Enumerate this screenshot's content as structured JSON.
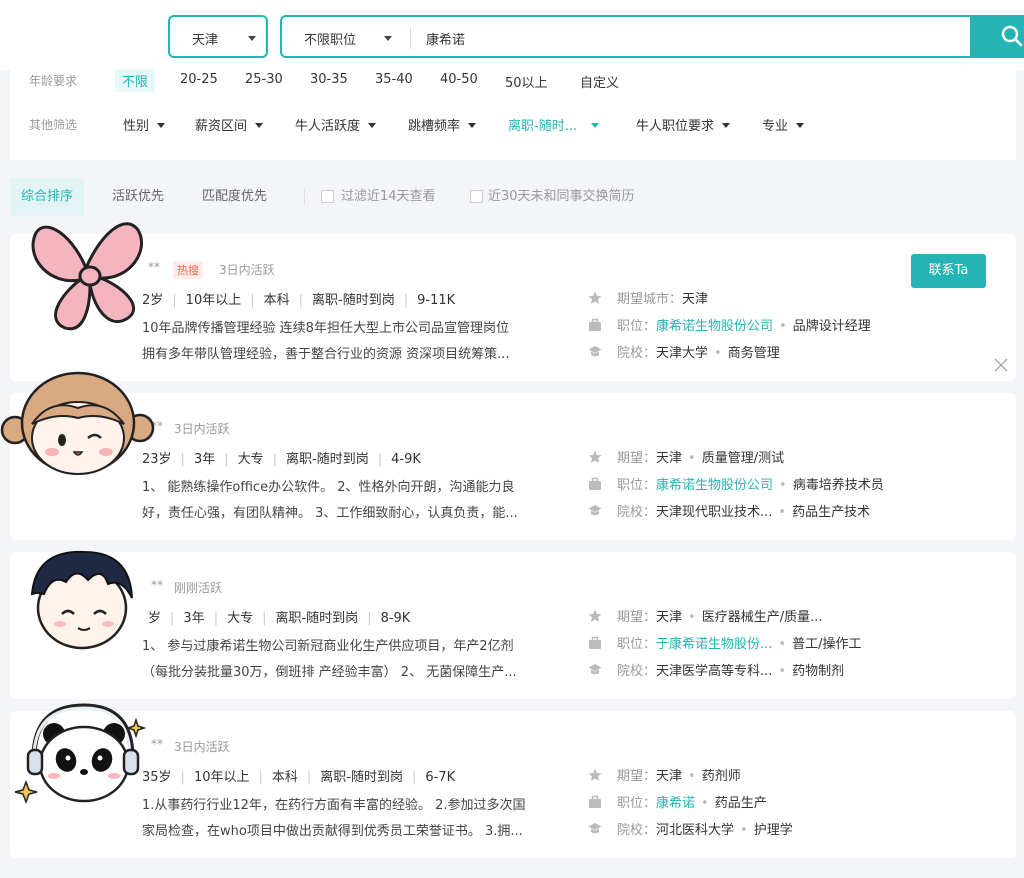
{
  "search": {
    "city": "天津",
    "position": "不限职位",
    "keyword": "康希诺"
  },
  "filters": {
    "age_label": "年龄要求",
    "age_options": [
      "不限",
      "20-25",
      "25-30",
      "30-35",
      "35-40",
      "40-50",
      "50以上",
      "自定义"
    ],
    "age_selected": "不限",
    "other_label": "其他筛选",
    "dropdowns": [
      "性别",
      "薪资区间",
      "牛人活跃度",
      "跳槽频率",
      "离职-随时...",
      "牛人职位要求",
      "专业"
    ],
    "active_dropdown": "离职-随时..."
  },
  "sort": {
    "tabs": [
      "综合排序",
      "活跃优先",
      "匹配度优先"
    ],
    "active": "综合排序",
    "checkboxes": [
      "过滤近14天查看",
      "近30天未和同事交换简历"
    ]
  },
  "candidates": [
    {
      "name": "**",
      "hot": "热搜",
      "active": "3日内活跃",
      "meta": [
        "2岁",
        "10年以上",
        "本科",
        "离职-随时到岗",
        "9-11K"
      ],
      "desc1": "10年品牌传播管理经验 连续8年担任大型上市公司品宣管理岗位",
      "desc2": "拥有多年带队管理经验，善于整合行业的资源 资深项目统筹策...",
      "expect_label": "期望城市：",
      "expect": "天津",
      "expect_extra": "",
      "job_label": "职位：",
      "company": "康希诺生物股份公司",
      "job": "品牌设计经理",
      "school_label": "院校：",
      "school": "天津大学",
      "major": "商务管理",
      "contact": "联系Ta"
    },
    {
      "name": "**",
      "hot": "",
      "active": "3日内活跃",
      "meta": [
        "23岁",
        "3年",
        "大专",
        "离职-随时到岗",
        "4-9K"
      ],
      "desc1": "1、 能熟练操作office办公软件。 2、性格外向开朗，沟通能力良",
      "desc2": "好，责任心强，有团队精神。 3、工作细致耐心，认真负责，能...",
      "expect_label": "期望：",
      "expect": "天津",
      "expect_extra": "质量管理/测试",
      "job_label": "职位：",
      "company": "康希诺生物股份公司",
      "job": "病毒培养技术员",
      "school_label": "院校：",
      "school": "天津现代职业技术...",
      "major": "药品生产技术"
    },
    {
      "name": "**",
      "hot": "",
      "active": "刚刚活跃",
      "meta": [
        "岁",
        "3年",
        "大专",
        "离职-随时到岗",
        "8-9K"
      ],
      "desc1": "1、 参与过康希诺生物公司新冠商业化生产供应项目，年产2亿剂",
      "desc2": "（每批分装批量30万，倒班排 产经验丰富） 2、 无菌保障生产...",
      "expect_label": "期望：",
      "expect": "天津",
      "expect_extra": "医疗器械生产/质量...",
      "job_label": "职位：",
      "company": "于康希诺生物股份...",
      "job": "普工/操作工",
      "school_label": "院校：",
      "school": "天津医学高等专科...",
      "major": "药物制剂"
    },
    {
      "name": "**",
      "hot": "",
      "active": "3日内活跃",
      "meta": [
        "35岁",
        "10年以上",
        "本科",
        "离职-随时到岗",
        "6-7K"
      ],
      "desc1": "1.从事药行行业12年，在药行方面有丰富的经验。 2.参加过多次国",
      "desc2": "家局检查，在who项目中做出贡献得到优秀员工荣誉证书。 3.拥...",
      "expect_label": "期望：",
      "expect": "天津",
      "expect_extra": "药剂师",
      "job_label": "职位：",
      "company": "康希诺",
      "job": "药品生产",
      "school_label": "院校：",
      "school": "河北医科大学",
      "major": "护理学"
    }
  ],
  "colors": {
    "accent": "#25b4b4",
    "hot": "#f26a4b"
  },
  "icons": [
    "search-icon",
    "star-icon",
    "briefcase-icon",
    "graduation-icon",
    "close-icon",
    "caret-down-icon"
  ]
}
